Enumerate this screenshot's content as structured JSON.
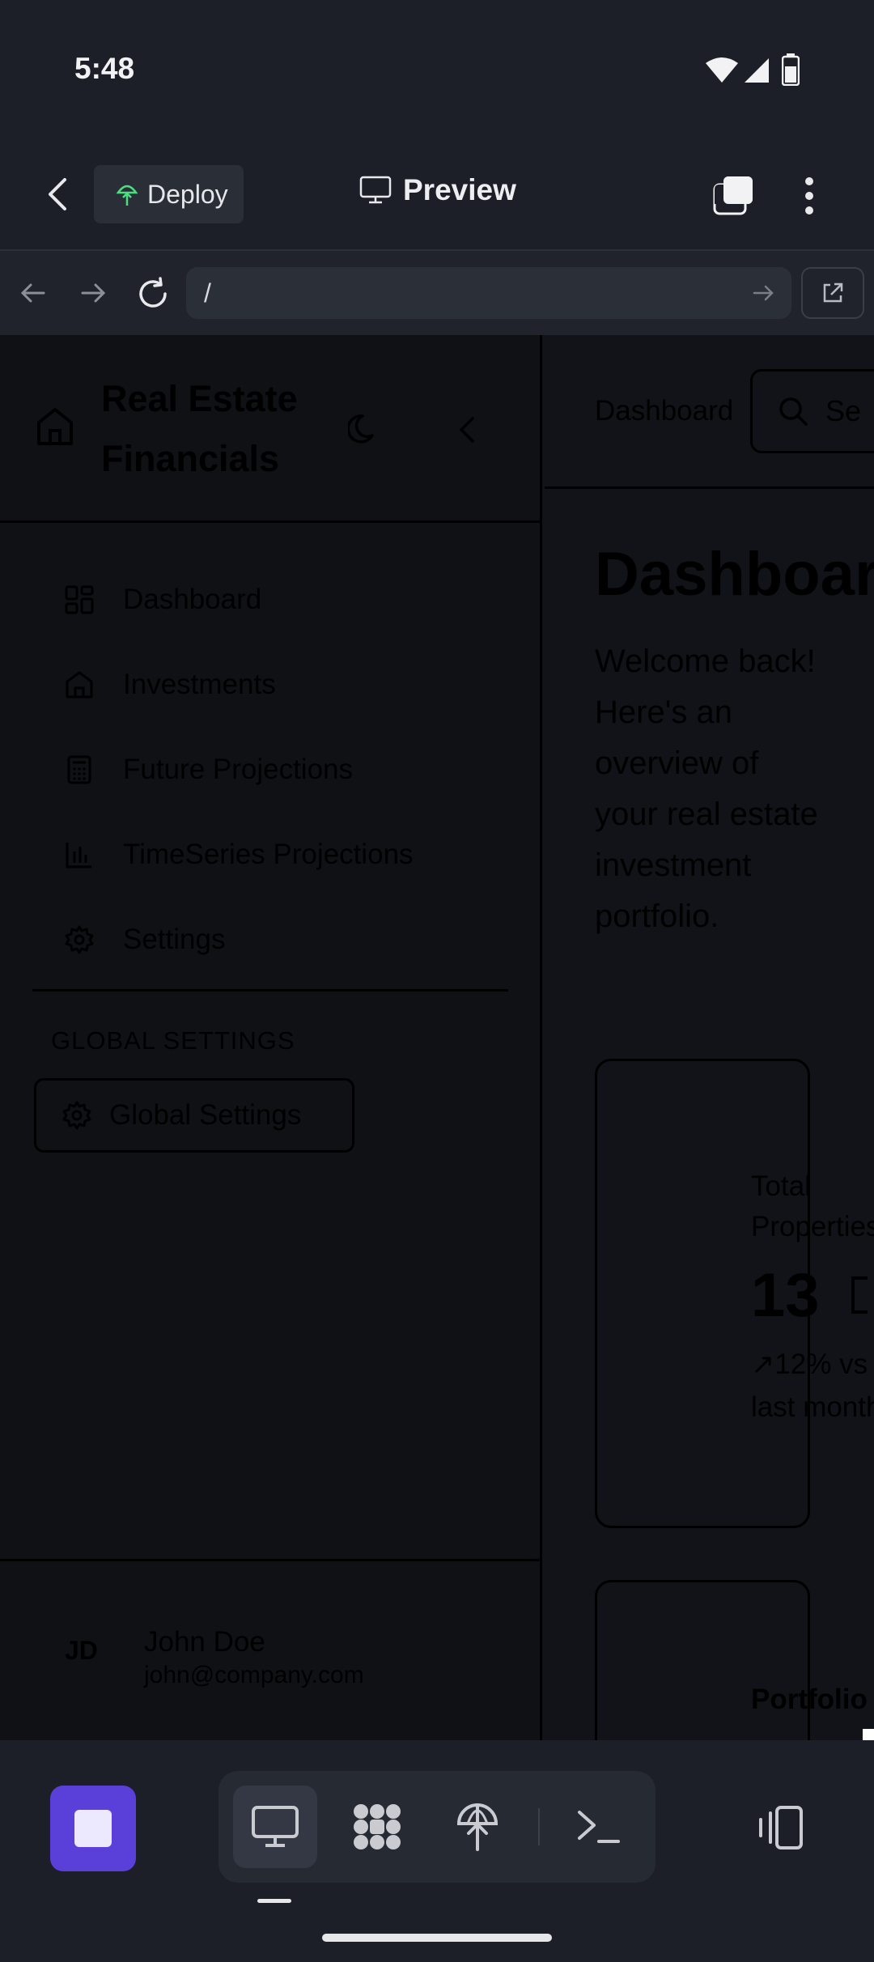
{
  "status_bar": {
    "time": "5:48"
  },
  "app_header": {
    "deploy_label": "Deploy",
    "preview_label": "Preview"
  },
  "browser": {
    "url": "/"
  },
  "sidebar": {
    "brand_line1": "Real Estate",
    "brand_line2": "Financials",
    "items": [
      {
        "label": "Dashboard",
        "icon": "grid-icon"
      },
      {
        "label": "Investments",
        "icon": "home-icon"
      },
      {
        "label": "Future Projections",
        "icon": "calculator-icon"
      },
      {
        "label": "TimeSeries Projections",
        "icon": "bar-chart-icon"
      },
      {
        "label": "Settings",
        "icon": "gear-icon"
      }
    ],
    "global_settings_title": "GLOBAL SETTINGS",
    "global_settings_button": "Global Settings",
    "user": {
      "initials": "JD",
      "name": "John Doe",
      "email": "john@company.com"
    }
  },
  "main": {
    "breadcrumb": "Dashboard",
    "search_placeholder": "Se",
    "title": "Dashboard",
    "subtitle": "Welcome back! Here's an overview of your real estate investment portfolio.",
    "cards": [
      {
        "label_l1": "Total",
        "label_l2": "Properties",
        "value": "13",
        "trend_l1": "↗12% vs",
        "trend_l2": "last month"
      },
      {
        "label_l1": "Portfolio Va"
      }
    ]
  },
  "colors": {
    "accent": "#5b3fd9",
    "background": "#1c1f27",
    "deploy_icon": "#4ade80"
  }
}
